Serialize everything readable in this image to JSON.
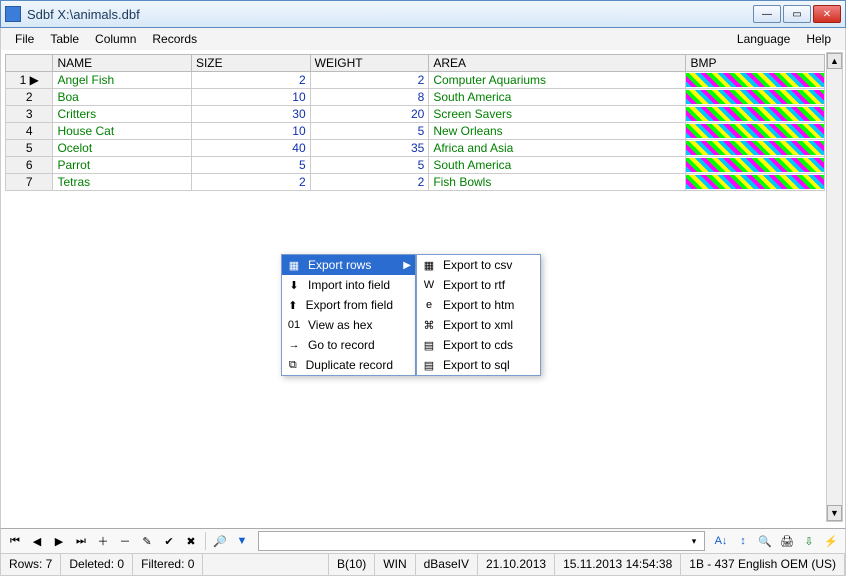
{
  "window": {
    "title": "Sdbf X:\\animals.dbf"
  },
  "menubar": {
    "file": "File",
    "table": "Table",
    "column": "Column",
    "records": "Records",
    "language": "Language",
    "help": "Help"
  },
  "grid": {
    "headers": {
      "name": "NAME",
      "size": "SIZE",
      "weight": "WEIGHT",
      "area": "AREA",
      "bmp": "BMP"
    },
    "rows": [
      {
        "n": "1",
        "name": "Angel Fish",
        "size": "2",
        "weight": "2",
        "area": "Computer Aquariums"
      },
      {
        "n": "2",
        "name": "Boa",
        "size": "10",
        "weight": "8",
        "area": "South America"
      },
      {
        "n": "3",
        "name": "Critters",
        "size": "30",
        "weight": "20",
        "area": "Screen Savers"
      },
      {
        "n": "4",
        "name": "House Cat",
        "size": "10",
        "weight": "5",
        "area": "New Orleans"
      },
      {
        "n": "5",
        "name": "Ocelot",
        "size": "40",
        "weight": "35",
        "area": "Africa and Asia"
      },
      {
        "n": "6",
        "name": "Parrot",
        "size": "5",
        "weight": "5",
        "area": "South America"
      },
      {
        "n": "7",
        "name": "Tetras",
        "size": "2",
        "weight": "2",
        "area": "Fish Bowls"
      }
    ]
  },
  "context_main": {
    "items": [
      {
        "label": "Export rows",
        "icon": "table-export",
        "submenu": true,
        "selected": true
      },
      {
        "label": "Import into field",
        "icon": "import"
      },
      {
        "label": "Export from field",
        "icon": "export"
      },
      {
        "label": "View as hex",
        "icon": "hex"
      },
      {
        "label": "Go to record",
        "icon": "goto"
      },
      {
        "label": "Duplicate record",
        "icon": "duplicate"
      }
    ]
  },
  "context_sub": {
    "items": [
      {
        "label": "Export to csv",
        "icon": "csv"
      },
      {
        "label": "Export to rtf",
        "icon": "rtf"
      },
      {
        "label": "Export to htm",
        "icon": "htm"
      },
      {
        "label": "Export to xml",
        "icon": "xml"
      },
      {
        "label": "Export to cds",
        "icon": "cds"
      },
      {
        "label": "Export to sql",
        "icon": "sql"
      }
    ]
  },
  "statusbar": {
    "rows": "Rows: 7",
    "deleted": "Deleted: 0",
    "filtered": "Filtered: 0",
    "fieldtype": "B(10)",
    "charset": "WIN",
    "dbtype": "dBaseIV",
    "date1": "21.10.2013",
    "date2": "15.11.2013 14:54:38",
    "codepage": "1B - 437 English OEM (US)"
  }
}
